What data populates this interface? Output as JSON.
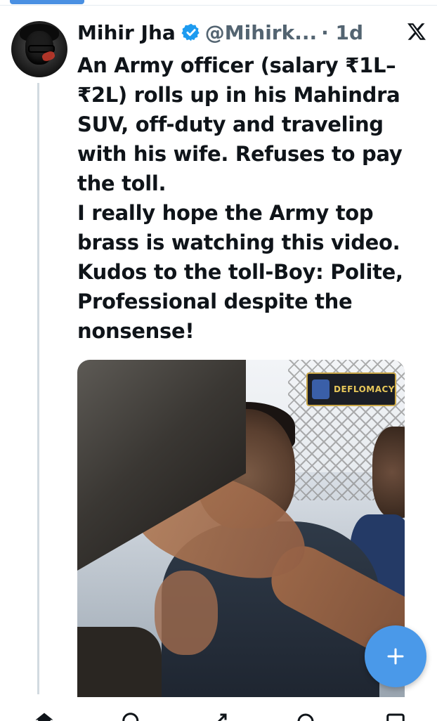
{
  "colors": {
    "accent": "#4a99e9",
    "verified": "#1d9bf0",
    "text_primary": "#0f1419",
    "text_secondary": "#536471",
    "thread_line": "#d2dae0"
  },
  "tweet": {
    "author_name": "Mihir Jha",
    "verified": true,
    "handle": "@Mihirk...",
    "time": "· 1d",
    "text_lines": [
      "An Army officer (salary ₹1L–₹2L) rolls up in his Mahindra SUV, off-duty and traveling with his wife. Refuses to pay the toll.",
      "I really hope the Army top brass is watching this video.",
      "Kudos to the toll-Boy: Polite, Professional despite the nonsense!"
    ],
    "media": {
      "type": "video",
      "watermark": "DEFLOMACY"
    }
  },
  "icons": {
    "close": "x-logo-icon",
    "fab": "plus-icon",
    "nav": [
      "home-icon",
      "search-icon",
      "grok-icon",
      "notifications-icon",
      "messages-icon"
    ]
  }
}
